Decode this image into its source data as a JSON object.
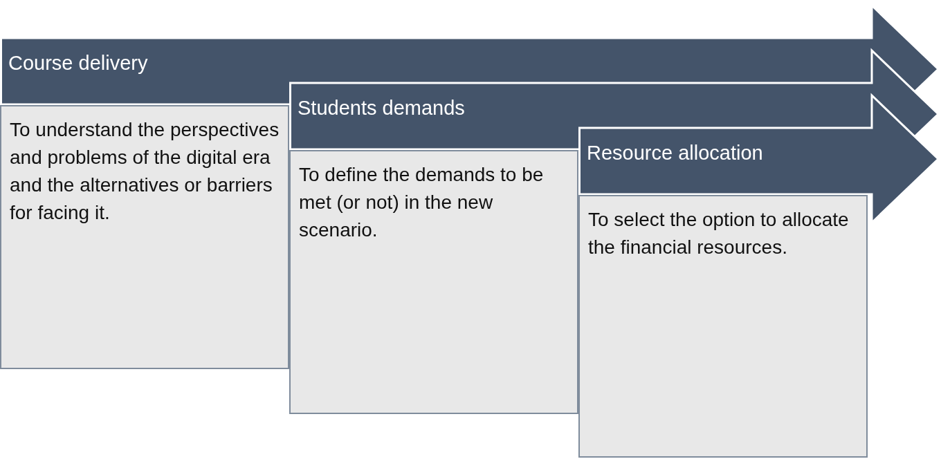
{
  "stages": [
    {
      "title": "Course delivery",
      "description": "To understand the perspectives and problems of the digital era and the alternatives or barriers for facing it."
    },
    {
      "title": "Students demands",
      "description": "To define the demands to be met (or not) in the new scenario."
    },
    {
      "title": "Resource allocation",
      "description": "To select the option to allocate the financial resources."
    }
  ]
}
